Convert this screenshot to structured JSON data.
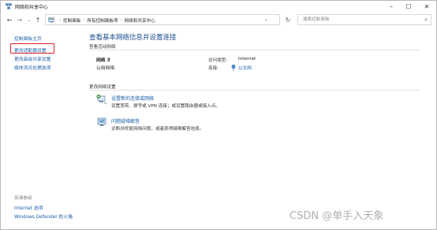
{
  "window": {
    "title": "网络和共享中心",
    "minimize": "–",
    "maximize": "☐",
    "close": "✕"
  },
  "nav": {
    "back": "←",
    "forward": "→",
    "recent": "⌄",
    "up": "↑",
    "breadcrumbs": [
      "控制面板",
      "所有控制面板项",
      "网络和共享中心"
    ],
    "breadcrumb_sep": "›",
    "dropdown": "⌄",
    "refresh": "↻",
    "search_placeholder": "搜索控制面板",
    "search_icon": "⌕"
  },
  "sidebar": {
    "home": "控制面板主页",
    "items": [
      {
        "label": "更改适配器设置",
        "highlighted": true
      },
      {
        "label": "更改高级共享设置",
        "highlighted": false
      },
      {
        "label": "媒体流式处理选项",
        "highlighted": false
      }
    ],
    "see_also_title": "另请参阅",
    "see_also": [
      "Internet 选项",
      "Windows Defender 防火墙"
    ]
  },
  "main": {
    "heading": "查看基本网络信息并设置连接",
    "active_networks_label": "查看活动网络",
    "network": {
      "name": "网络 3",
      "category": "公用网络",
      "access_type_label": "访问类型:",
      "access_type_value": "Internet",
      "connections_label": "连接:",
      "connections_value": "以太网"
    },
    "change_settings_label": "更改网络设置",
    "tasks": [
      {
        "icon": "new-connection-icon",
        "title": "设置新的连接或网络",
        "desc": "设置宽带、拨号或 VPN 连接；或设置路由器或接入点。"
      },
      {
        "icon": "troubleshoot-icon",
        "title": "问题疑难解答",
        "desc": "诊断并修复网络问题，或者获得疑难解答信息。"
      }
    ]
  },
  "watermark": "CSDN @单手入天象",
  "colors": {
    "link": "#1a5fa8",
    "heading": "#1a4f8f",
    "highlight": "#e0202a"
  }
}
